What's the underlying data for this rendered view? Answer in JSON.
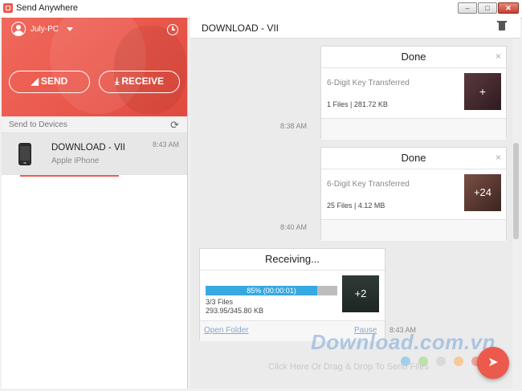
{
  "window": {
    "title": "Send Anywhere",
    "min": "0",
    "max": "1",
    "close": "r"
  },
  "sidebar": {
    "pc_name": "July-PC",
    "send_label": "SEND",
    "receive_label": "RECEIVE",
    "send_to_devices": "Send to Devices",
    "refresh_glyph": "⟳",
    "device": {
      "name": "DOWNLOAD - VII",
      "model": "Apple iPhone",
      "time": "8:43 AM"
    }
  },
  "main": {
    "title": "DOWNLOAD - VII",
    "cards": [
      {
        "status": "Done",
        "close": "×",
        "desc": "6-Digit Key Transferred",
        "meta": "1 Files | 281.72 KB",
        "thumb_label": "+",
        "time": "8:38 AM"
      },
      {
        "status": "Done",
        "close": "×",
        "desc": "6-Digit Key Transferred",
        "meta": "25 Files | 4.12 MB",
        "thumb_label": "+24",
        "time": "8:40 AM"
      }
    ],
    "receiving": {
      "status": "Receiving...",
      "progress_text": "85% (00:00:01)",
      "progress": 0.85,
      "files": "3/3 Files",
      "size": "293.95/345.80 KB",
      "thumb_label": "+2",
      "open_folder": "Open Folder",
      "pause": "Pause",
      "time": "8:43 AM"
    },
    "drop_hint": "Click Here Or Drag & Drop To Send Files",
    "fab_glyph": "➤"
  },
  "watermark": "Download.com.vn",
  "watermark_dots": [
    "#9fd0ea",
    "#bfe0a8",
    "#d9d9d9",
    "#f6c99a",
    "#f2a39a"
  ],
  "colors": {
    "accent": "#ec5a4e",
    "progress": "#35a9e0"
  }
}
